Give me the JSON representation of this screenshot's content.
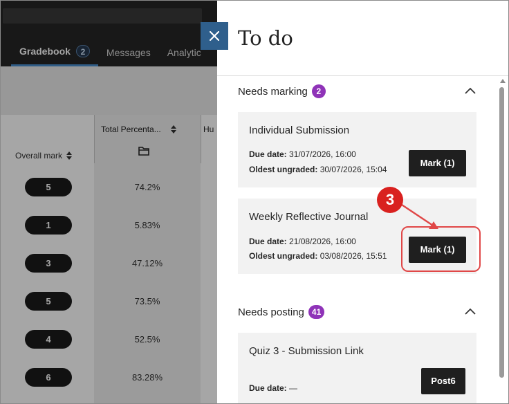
{
  "gradebook": {
    "tabs": [
      {
        "label": "Gradebook",
        "badge": "2"
      },
      {
        "label": "Messages"
      },
      {
        "label": "Analytic"
      }
    ],
    "columns": {
      "overall": "Overall mark",
      "total": "Total Percenta...",
      "partial": "Hu"
    },
    "rows": [
      {
        "mark": "5",
        "percent": "74.2%"
      },
      {
        "mark": "1",
        "percent": "5.83%"
      },
      {
        "mark": "3",
        "percent": "47.12%"
      },
      {
        "mark": "5",
        "percent": "73.5%"
      },
      {
        "mark": "4",
        "percent": "52.5%"
      },
      {
        "mark": "6",
        "percent": "83.28%"
      }
    ]
  },
  "panel": {
    "title": "To do",
    "needs_marking": {
      "label": "Needs marking",
      "count": "2",
      "items": [
        {
          "title": "Individual Submission",
          "due_label": "Due date:",
          "due_value": "31/07/2026, 16:00",
          "oldest_label": "Oldest ungraded:",
          "oldest_value": "30/07/2026, 15:04",
          "button": "Mark (1)"
        },
        {
          "title": "Weekly Reflective Journal",
          "due_label": "Due date:",
          "due_value": "21/08/2026, 16:00",
          "oldest_label": "Oldest ungraded:",
          "oldest_value": "03/08/2026, 15:51",
          "button": "Mark (1)"
        }
      ]
    },
    "needs_posting": {
      "label": "Needs posting",
      "count": "41",
      "items": [
        {
          "title": "Quiz 3 - Submission Link",
          "due_label": "Due date:",
          "due_value": "—",
          "button": "Post6"
        }
      ]
    }
  },
  "annotation": {
    "step": "3",
    "color": "#d9211f"
  },
  "colors": {
    "accent_purple": "#8f33b8",
    "close_blue": "#2f5f8c",
    "tab_underline": "#4a8fd0"
  }
}
